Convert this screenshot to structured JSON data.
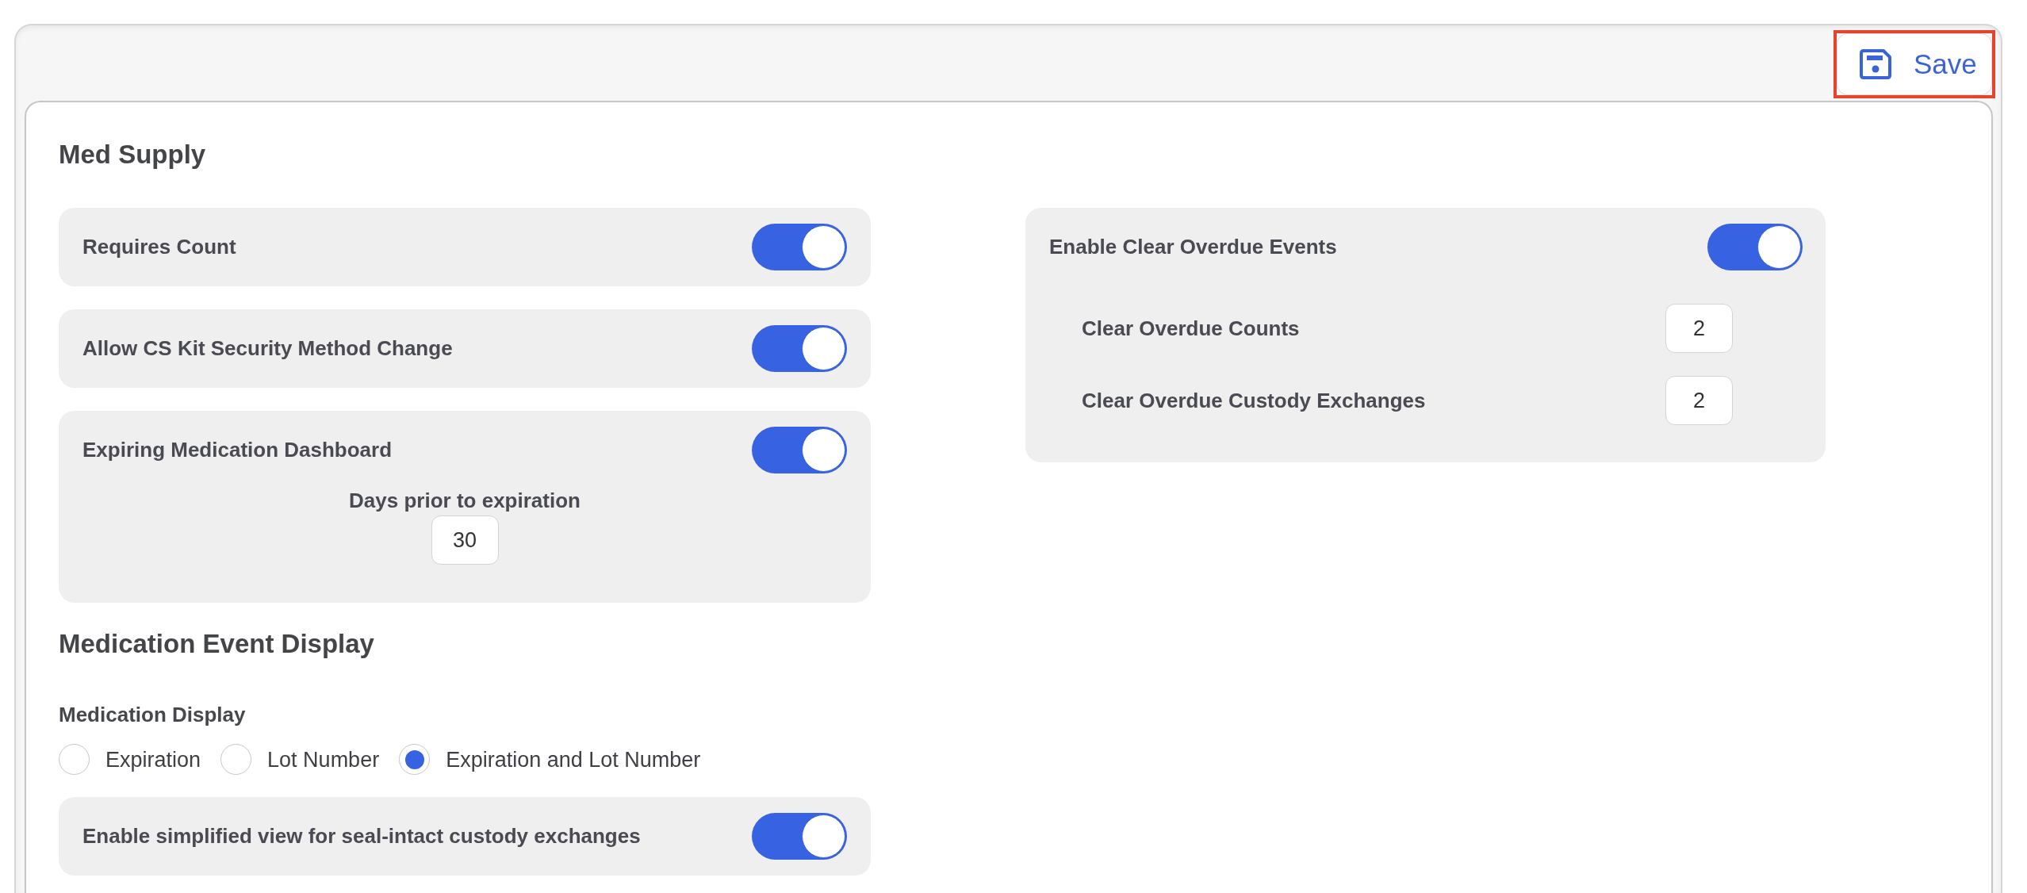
{
  "header": {
    "save_button": {
      "label": "Save",
      "highlighted": true
    }
  },
  "med_supply": {
    "title": "Med Supply",
    "settings": [
      {
        "label": "Requires Count",
        "on": true
      },
      {
        "label": "Allow CS Kit Security Method Change",
        "on": true
      },
      {
        "label": "Expiring Medication Dashboard",
        "on": true,
        "field": {
          "label": "Days prior to expiration",
          "value": "30"
        }
      }
    ]
  },
  "overdue_events": {
    "label": "Enable Clear Overdue Events",
    "on": true,
    "fields": [
      {
        "label": "Clear Overdue Counts",
        "value": "2"
      },
      {
        "label": "Clear Overdue Custody Exchanges",
        "value": "2"
      }
    ]
  },
  "medication_event_display": {
    "title": "Medication Event Display",
    "medication_display": {
      "label": "Medication Display",
      "options": [
        {
          "label": "Expiration",
          "selected": false
        },
        {
          "label": "Lot Number",
          "selected": false
        },
        {
          "label": "Expiration and Lot Number",
          "selected": true
        }
      ]
    },
    "settings": [
      {
        "label": "Enable simplified view for seal-intact custody exchanges",
        "on": true
      }
    ]
  }
}
